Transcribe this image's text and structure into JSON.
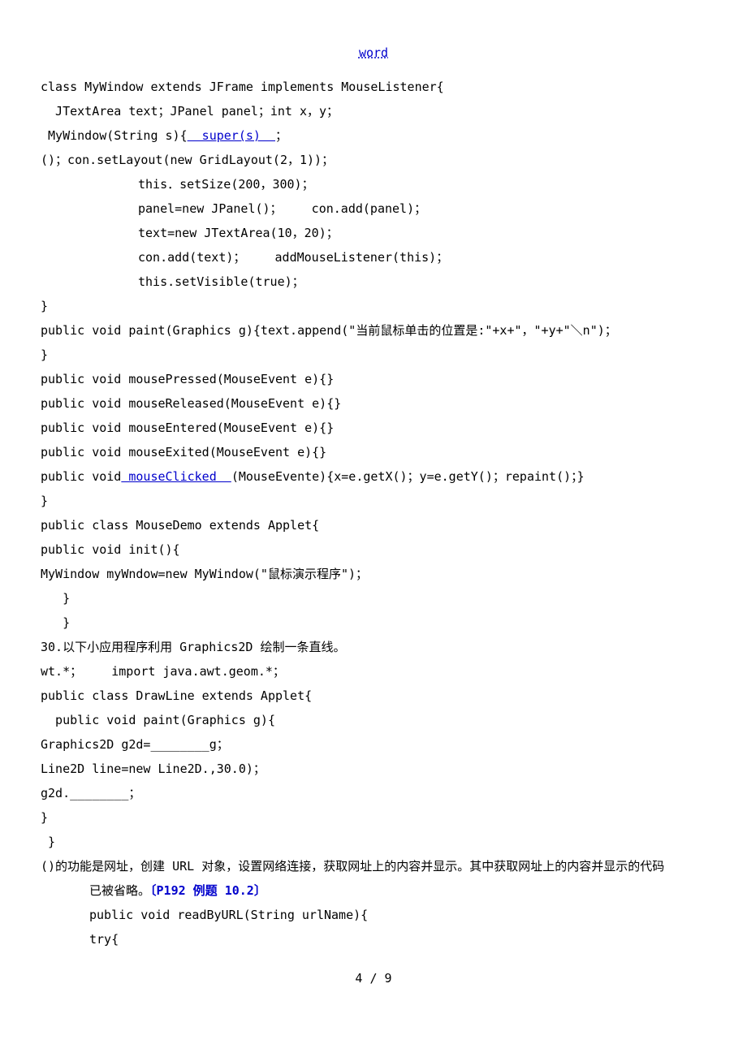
{
  "header": {
    "title": "word"
  },
  "lines": {
    "l1": "class MyWindow extends JFrame implements MouseListener{",
    "l2a": "  JTextArea text；JPanel panel；int x，y；",
    "l3a": " MyWindow(String s){",
    "l3b": "  super(s)  ",
    "l3c": "；",
    "l4": "()；con.setLayout(new GridLayout(2，1))；",
    "l5": "this．setSize(200，300)；",
    "l6": "panel=new JPanel()；    con.add(panel)；",
    "l7": "text=new JTextArea(10，20)；",
    "l8": "con.add(text)；    addMouseListener(this)；",
    "l9": "this.setVisible(true)；",
    "l10": "}",
    "l11": "public void paint(Graphics g){text.append(\"当前鼠标单击的位置是:\"+x+\"，\"+y+\"＼n\")；",
    "l12": "}",
    "l13": "public void mousePressed(MouseEvent e){}",
    "l14": "public void mouseReleased(MouseEvent e){}",
    "l15": "public void mouseEntered(MouseEvent e){}",
    "l16": "public void mouseExited(MouseEvent e){}",
    "l17a": "public void",
    "l17b": " mouseClicked  ",
    "l17c": "(MouseEvente){x=e.getX()；y=e.getY()；repaint()；}",
    "l18": "}",
    "l19": "public class MouseDemo extends Applet{",
    "l20": "public void init(){",
    "l21": "MyWindow myWndow=new MyWindow(\"鼠标演示程序\")；",
    "l22": "   }",
    "l23": "   }",
    "l24": "30.以下小应用程序利用 Graphics2D 绘制一条直线。",
    "l25": "wt.*；    import java.awt.geom.*；",
    "l26": "public class DrawLine extends Applet{",
    "l27": "  public void paint(Graphics g){",
    "l28": "Graphics2D g2d=________g；",
    "l29": "Line2D line=new Line2D.,30.0)；",
    "l30": "g2d.________；",
    "l31": "}",
    "l32": " }",
    "l33": "()的功能是网址，创建 URL 对象，设置网络连接，获取网址上的内容并显示。其中获取网址上的内容并显示的代码",
    "l34a": "已被省略。",
    "l34b": "〔P192 例题 10.2〕",
    "l35": "public void readByURL(String urlName){",
    "l36": "try{"
  },
  "footer": {
    "page": "4 / 9"
  }
}
